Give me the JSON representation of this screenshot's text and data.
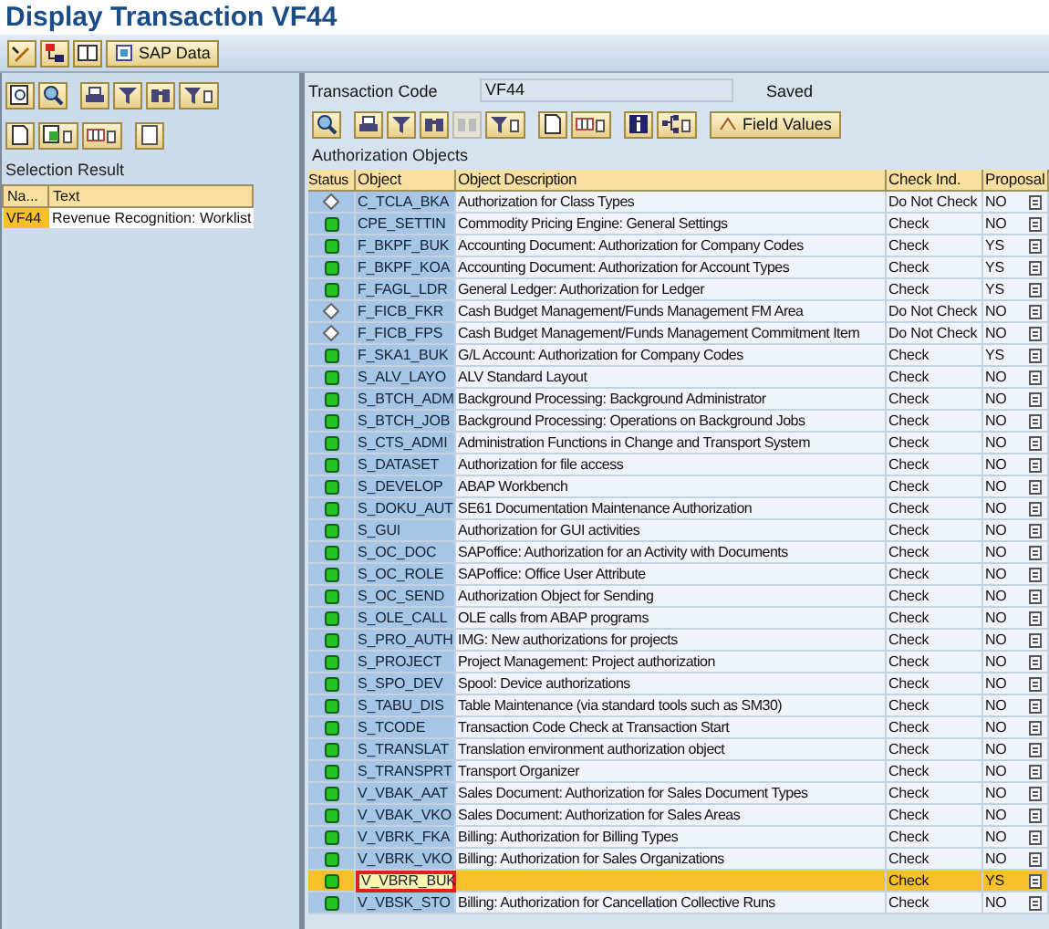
{
  "window": {
    "title": "Display Transaction VF44"
  },
  "app_toolbar": {
    "button": "SAP Data"
  },
  "left_panel": {
    "heading": "Selection Result",
    "columns": [
      "Na...",
      "Text"
    ],
    "rows": [
      {
        "name": "VF44",
        "text": "Revenue Recognition: Worklist",
        "selected": true
      }
    ]
  },
  "right_panel": {
    "transaction_code": {
      "label": "Transaction Code",
      "value": "VF44"
    },
    "status": "Saved",
    "field_values_button": "Field Values",
    "heading": "Authorization Objects",
    "columns": [
      "Status",
      "Object",
      "Object Description",
      "Check Ind.",
      "Proposal"
    ],
    "rows": [
      {
        "kind": "not_checked",
        "object": "C_TCLA_BKA",
        "description": "Authorization for Class Types",
        "check": "Do Not Check",
        "proposal": "NO",
        "selected": false
      },
      {
        "kind": "ok",
        "object": "CPE_SETTIN",
        "description": "Commodity Pricing Engine: General Settings",
        "check": "Check",
        "proposal": "NO",
        "selected": false
      },
      {
        "kind": "ok",
        "object": "F_BKPF_BUK",
        "description": "Accounting Document: Authorization for Company Codes",
        "check": "Check",
        "proposal": "YS",
        "selected": false
      },
      {
        "kind": "ok",
        "object": "F_BKPF_KOA",
        "description": "Accounting Document: Authorization for Account Types",
        "check": "Check",
        "proposal": "YS",
        "selected": false
      },
      {
        "kind": "ok",
        "object": "F_FAGL_LDR",
        "description": "General Ledger: Authorization for Ledger",
        "check": "Check",
        "proposal": "YS",
        "selected": false
      },
      {
        "kind": "not_checked",
        "object": "F_FICB_FKR",
        "description": "Cash Budget Management/Funds Management FM Area",
        "check": "Do Not Check",
        "proposal": "NO",
        "selected": false
      },
      {
        "kind": "not_checked",
        "object": "F_FICB_FPS",
        "description": "Cash Budget Management/Funds Management Commitment Item",
        "check": "Do Not Check",
        "proposal": "NO",
        "selected": false
      },
      {
        "kind": "ok",
        "object": "F_SKA1_BUK",
        "description": "G/L Account: Authorization for Company Codes",
        "check": "Check",
        "proposal": "YS",
        "selected": false
      },
      {
        "kind": "ok",
        "object": "S_ALV_LAYO",
        "description": "ALV Standard Layout",
        "check": "Check",
        "proposal": "NO",
        "selected": false
      },
      {
        "kind": "ok",
        "object": "S_BTCH_ADM",
        "description": "Background Processing: Background Administrator",
        "check": "Check",
        "proposal": "NO",
        "selected": false
      },
      {
        "kind": "ok",
        "object": "S_BTCH_JOB",
        "description": "Background Processing: Operations on Background Jobs",
        "check": "Check",
        "proposal": "NO",
        "selected": false
      },
      {
        "kind": "ok",
        "object": "S_CTS_ADMI",
        "description": "Administration Functions in Change and Transport System",
        "check": "Check",
        "proposal": "NO",
        "selected": false
      },
      {
        "kind": "ok",
        "object": "S_DATASET",
        "description": "Authorization for file access",
        "check": "Check",
        "proposal": "NO",
        "selected": false
      },
      {
        "kind": "ok",
        "object": "S_DEVELOP",
        "description": "ABAP Workbench",
        "check": "Check",
        "proposal": "NO",
        "selected": false
      },
      {
        "kind": "ok",
        "object": "S_DOKU_AUT",
        "description": "SE61 Documentation Maintenance Authorization",
        "check": "Check",
        "proposal": "NO",
        "selected": false
      },
      {
        "kind": "ok",
        "object": "S_GUI",
        "description": "Authorization for GUI activities",
        "check": "Check",
        "proposal": "NO",
        "selected": false
      },
      {
        "kind": "ok",
        "object": "S_OC_DOC",
        "description": "SAPoffice: Authorization for an Activity with Documents",
        "check": "Check",
        "proposal": "NO",
        "selected": false
      },
      {
        "kind": "ok",
        "object": "S_OC_ROLE",
        "description": "SAPoffice: Office User Attribute",
        "check": "Check",
        "proposal": "NO",
        "selected": false
      },
      {
        "kind": "ok",
        "object": "S_OC_SEND",
        "description": "Authorization Object for Sending",
        "check": "Check",
        "proposal": "NO",
        "selected": false
      },
      {
        "kind": "ok",
        "object": "S_OLE_CALL",
        "description": "OLE calls from ABAP programs",
        "check": "Check",
        "proposal": "NO",
        "selected": false
      },
      {
        "kind": "ok",
        "object": "S_PRO_AUTH",
        "description": "IMG: New authorizations for projects",
        "check": "Check",
        "proposal": "NO",
        "selected": false
      },
      {
        "kind": "ok",
        "object": "S_PROJECT",
        "description": "Project Management: Project authorization",
        "check": "Check",
        "proposal": "NO",
        "selected": false
      },
      {
        "kind": "ok",
        "object": "S_SPO_DEV",
        "description": "Spool: Device authorizations",
        "check": "Check",
        "proposal": "NO",
        "selected": false
      },
      {
        "kind": "ok",
        "object": "S_TABU_DIS",
        "description": "Table Maintenance (via standard tools such as SM30)",
        "check": "Check",
        "proposal": "NO",
        "selected": false
      },
      {
        "kind": "ok",
        "object": "S_TCODE",
        "description": "Transaction Code Check at Transaction Start",
        "check": "Check",
        "proposal": "NO",
        "selected": false
      },
      {
        "kind": "ok",
        "object": "S_TRANSLAT",
        "description": "Translation environment authorization object",
        "check": "Check",
        "proposal": "NO",
        "selected": false
      },
      {
        "kind": "ok",
        "object": "S_TRANSPRT",
        "description": "Transport Organizer",
        "check": "Check",
        "proposal": "NO",
        "selected": false
      },
      {
        "kind": "ok",
        "object": "V_VBAK_AAT",
        "description": "Sales Document: Authorization for Sales Document Types",
        "check": "Check",
        "proposal": "NO",
        "selected": false
      },
      {
        "kind": "ok",
        "object": "V_VBAK_VKO",
        "description": "Sales Document: Authorization for Sales Areas",
        "check": "Check",
        "proposal": "NO",
        "selected": false
      },
      {
        "kind": "ok",
        "object": "V_VBRK_FKA",
        "description": "Billing: Authorization for Billing Types",
        "check": "Check",
        "proposal": "NO",
        "selected": false
      },
      {
        "kind": "ok",
        "object": "V_VBRK_VKO",
        "description": "Billing: Authorization for Sales Organizations",
        "check": "Check",
        "proposal": "NO",
        "selected": false
      },
      {
        "kind": "ok",
        "object": "V_VBRR_BUK",
        "check": "Check",
        "proposal": "YS",
        "selected": true,
        "highlighted": true
      },
      {
        "kind": "ok",
        "object": "V_VBSK_STO",
        "description": "Billing: Authorization for Cancellation Collective Runs",
        "check": "Check",
        "proposal": "NO",
        "selected": false
      }
    ]
  }
}
